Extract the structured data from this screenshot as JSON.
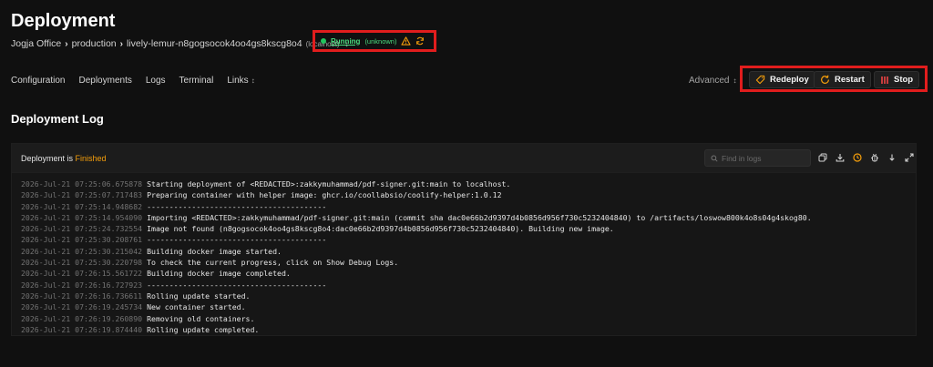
{
  "page": {
    "title": "Deployment",
    "section_title": "Deployment Log"
  },
  "breadcrumb": {
    "team": "Jogja Office",
    "project": "production",
    "resource": "lively-lemur-n8gogsocok4oo4gs8kscg8o4",
    "server": "(localhost)"
  },
  "status": {
    "label": "Running",
    "health": "(unknown)",
    "color": "#4ade80"
  },
  "nav": {
    "configuration": "Configuration",
    "deployments": "Deployments",
    "logs": "Logs",
    "terminal": "Terminal",
    "links": "Links",
    "advanced": "Advanced"
  },
  "actions": {
    "redeploy": "Redeploy",
    "restart": "Restart",
    "stop": "Stop"
  },
  "log": {
    "status_prefix": "Deployment is ",
    "status_value": "Finished",
    "search_placeholder": "Find in logs",
    "lines": [
      {
        "ts": "2026-Jul-21 07:25:06.675878",
        "msg": "Starting deployment of <REDACTED>:zakkymuhammad/pdf-signer.git:main to localhost."
      },
      {
        "ts": "2026-Jul-21 07:25:07.717483",
        "msg": "Preparing container with helper image: ghcr.io/coollabsio/coolify-helper:1.0.12"
      },
      {
        "ts": "2026-Jul-21 07:25:14.948682",
        "msg": "----------------------------------------"
      },
      {
        "ts": "2026-Jul-21 07:25:14.954090",
        "msg": "Importing <REDACTED>:zakkymuhammad/pdf-signer.git:main (commit sha dac0e66b2d9397d4b0856d956f730c5232404840) to /artifacts/loswow800k4o8s04g4skog80."
      },
      {
        "ts": "2026-Jul-21 07:25:24.732554",
        "msg": "Image not found (n8gogsocok4oo4gs8kscg8o4:dac0e66b2d9397d4b0856d956f730c5232404840). Building new image."
      },
      {
        "ts": "2026-Jul-21 07:25:30.208761",
        "msg": "----------------------------------------"
      },
      {
        "ts": "2026-Jul-21 07:25:30.215042",
        "msg": "Building docker image started."
      },
      {
        "ts": "2026-Jul-21 07:25:30.220798",
        "msg": "To check the current progress, click on Show Debug Logs."
      },
      {
        "ts": "2026-Jul-21 07:26:15.561722",
        "msg": "Building docker image completed."
      },
      {
        "ts": "2026-Jul-21 07:26:16.727923",
        "msg": "----------------------------------------"
      },
      {
        "ts": "2026-Jul-21 07:26:16.736611",
        "msg": "Rolling update started."
      },
      {
        "ts": "2026-Jul-21 07:26:19.245734",
        "msg": "New container started."
      },
      {
        "ts": "2026-Jul-21 07:26:19.260890",
        "msg": "Removing old containers."
      },
      {
        "ts": "2026-Jul-21 07:26:19.874440",
        "msg": "Rolling update completed."
      }
    ]
  },
  "colors": {
    "background": "#101010",
    "accent_warning": "#f59e0b",
    "stop_red": "#ef4444",
    "highlight_box": "#e11d1d"
  },
  "icons": {
    "status": "status-dot",
    "warning": "warning-triangle-icon",
    "refresh": "refresh-icon",
    "redeploy": "tag-icon",
    "restart": "restart-icon",
    "stop": "stop-icon"
  }
}
